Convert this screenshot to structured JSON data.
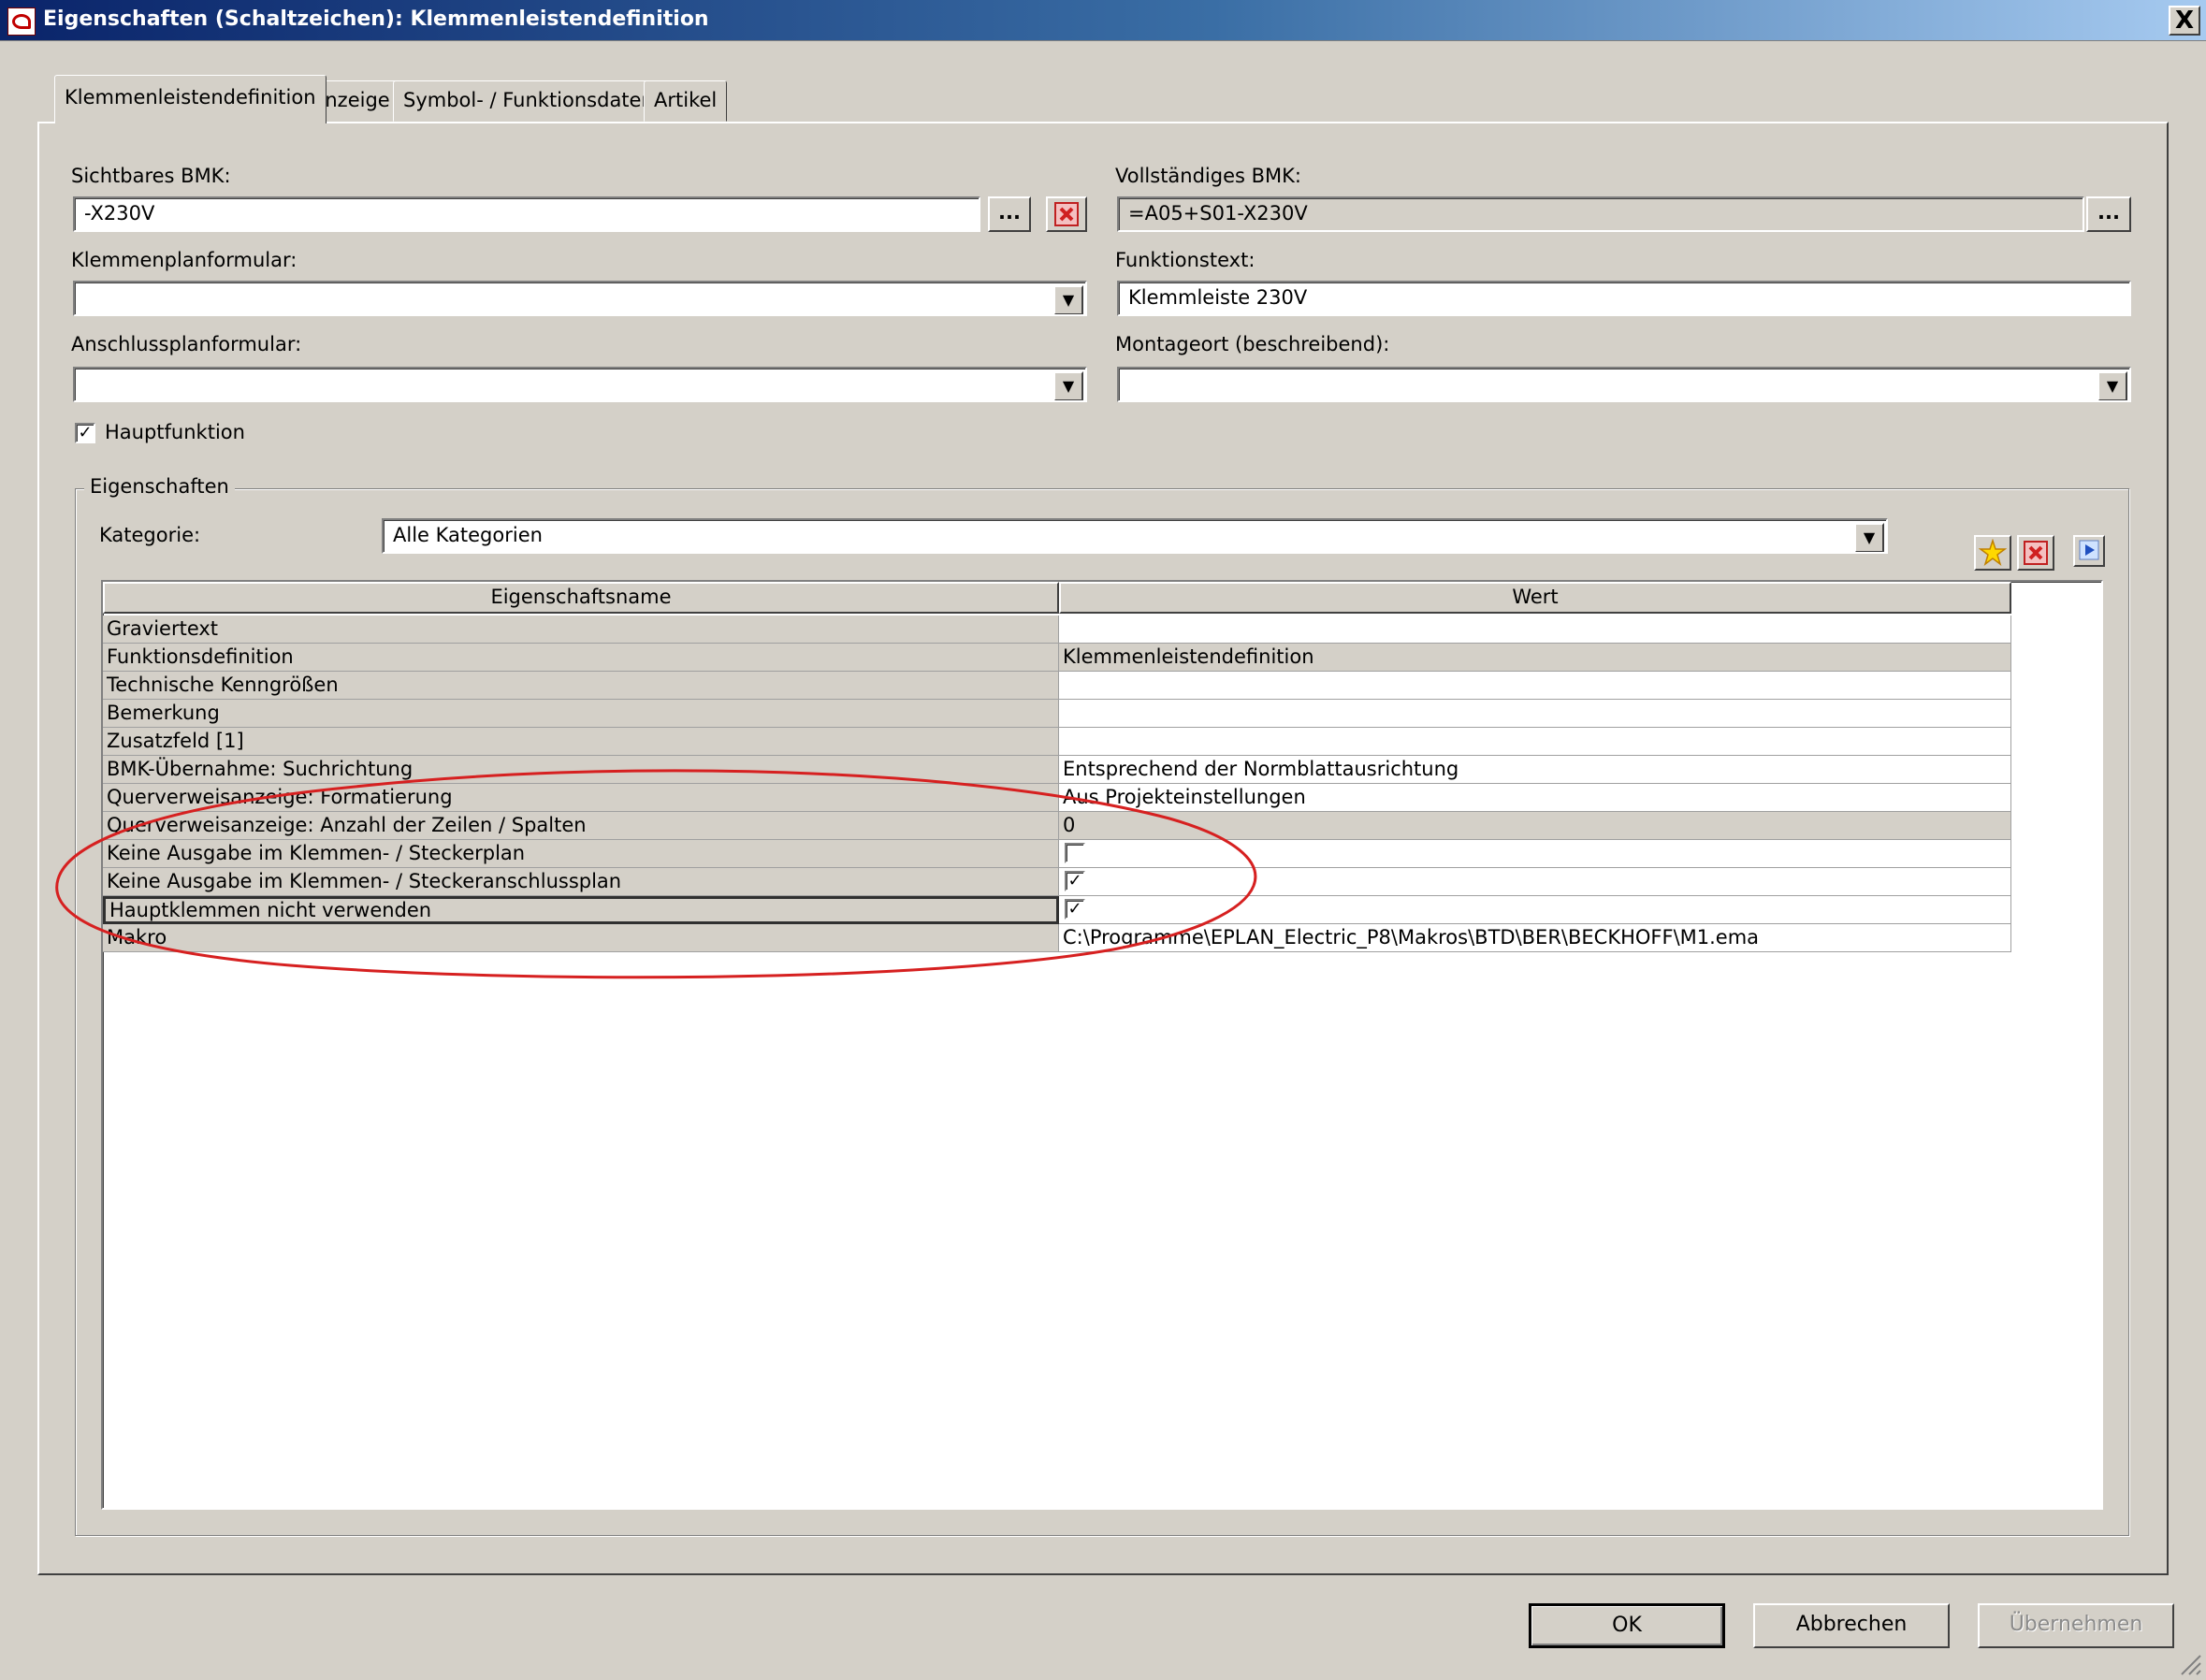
{
  "window": {
    "title": "Eigenschaften (Schaltzeichen): Klemmenleistendefinition",
    "close_label": "X"
  },
  "tabs": [
    {
      "label": "Klemmenleistendefinition",
      "active": true
    },
    {
      "label": "Anzeige",
      "active": false
    },
    {
      "label": "Symbol- / Funktionsdaten",
      "active": false
    },
    {
      "label": "Artikel",
      "active": false
    }
  ],
  "form": {
    "sichtbares_bmk": {
      "label": "Sichtbares BMK:",
      "value": "-X230V",
      "browse_label": "..."
    },
    "vollstaendiges_bmk": {
      "label": "Vollständiges BMK:",
      "value": "=A05+S01-X230V",
      "browse_label": "..."
    },
    "klemmenplanformular": {
      "label": "Klemmenplanformular:",
      "value": ""
    },
    "funktionstext": {
      "label": "Funktionstext:",
      "value": "Klemmleiste 230V"
    },
    "anschlussplanformular": {
      "label": "Anschlussplanformular:",
      "value": ""
    },
    "montageort": {
      "label": "Montageort (beschreibend):",
      "value": ""
    },
    "hauptfunktion": {
      "label": "Hauptfunktion",
      "checked": true
    }
  },
  "properties": {
    "group_title": "Eigenschaften",
    "kategorie_label": "Kategorie:",
    "kategorie_value": "Alle Kategorien",
    "columns": [
      "Eigenschaftsname",
      "Wert"
    ],
    "rows": [
      {
        "name": "Graviertext",
        "value": "",
        "type": "text"
      },
      {
        "name": "Funktionsdefinition",
        "value": "Klemmenleistendefinition",
        "type": "readonly"
      },
      {
        "name": "Technische Kenngrößen",
        "value": "",
        "type": "text"
      },
      {
        "name": "Bemerkung",
        "value": "",
        "type": "text"
      },
      {
        "name": "Zusatzfeld [1]",
        "value": "",
        "type": "text"
      },
      {
        "name": "BMK-Übernahme: Suchrichtung",
        "value": "Entsprechend der Normblattausrichtung",
        "type": "text"
      },
      {
        "name": "Querverweisanzeige: Formatierung",
        "value": "Aus Projekteinstellungen",
        "type": "text"
      },
      {
        "name": "Querverweisanzeige: Anzahl der Zeilen / Spalten",
        "value": "0",
        "type": "readonly"
      },
      {
        "name": "Keine Ausgabe im Klemmen- / Steckerplan",
        "value": "",
        "type": "checkbox",
        "checked": false
      },
      {
        "name": "Keine Ausgabe im Klemmen- / Steckeranschlussplan",
        "value": "",
        "type": "checkbox",
        "checked": true
      },
      {
        "name": "Hauptklemmen nicht verwenden",
        "value": "",
        "type": "checkbox",
        "checked": true
      },
      {
        "name": "Makro",
        "value": "C:\\Programme\\EPLAN_Electric_P8\\Makros\\BTD\\BER\\BECKHOFF\\M1.ema",
        "type": "text"
      }
    ]
  },
  "buttons": {
    "ok": "OK",
    "cancel": "Abbrechen",
    "apply": "Übernehmen"
  },
  "colors": {
    "annotation_ellipse": "#d62020",
    "titlebar_start": "#0a246a",
    "titlebar_end": "#a6caf0"
  }
}
